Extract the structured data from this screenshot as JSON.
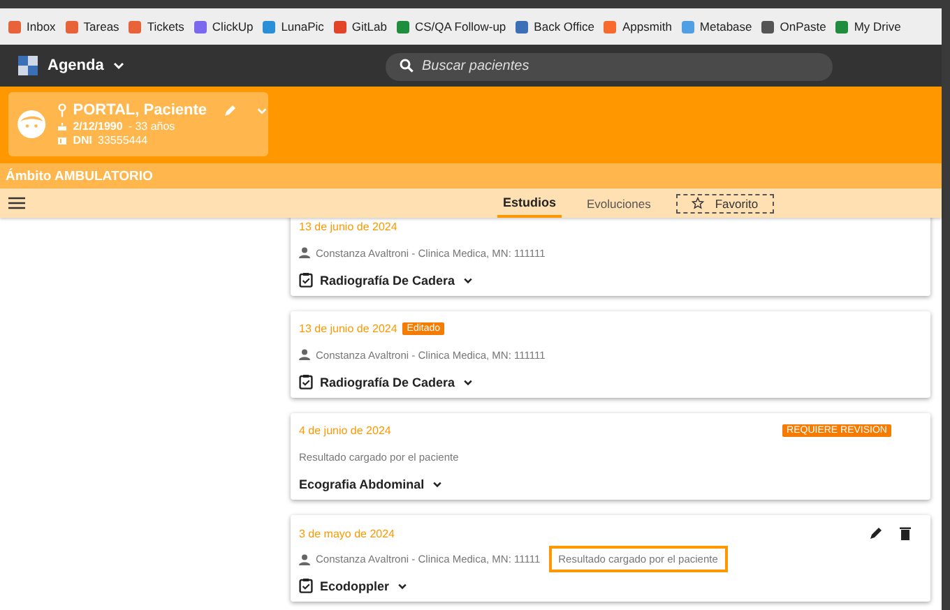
{
  "bookmarks": [
    {
      "label": "Inbox",
      "color": "#e8633a"
    },
    {
      "label": "Tareas",
      "color": "#e8633a"
    },
    {
      "label": "Tickets",
      "color": "#e8633a"
    },
    {
      "label": "ClickUp",
      "color": "#7b68ee"
    },
    {
      "label": "LunaPic",
      "color": "#2a8fd6"
    },
    {
      "label": "GitLab",
      "color": "#e24329"
    },
    {
      "label": "CS/QA Follow-up",
      "color": "#1e8e3e"
    },
    {
      "label": "Back Office",
      "color": "#3b6fb6"
    },
    {
      "label": "Appsmith",
      "color": "#f86a2b"
    },
    {
      "label": "Metabase",
      "color": "#509ee3"
    },
    {
      "label": "OnPaste",
      "color": "#555555"
    },
    {
      "label": "My Drive",
      "color": "#1e8e3e"
    }
  ],
  "app_bar": {
    "title": "Agenda",
    "search": {
      "placeholder": "Buscar pacientes"
    }
  },
  "patient": {
    "name": "PORTAL, Paciente",
    "birth_date": "2/12/1990",
    "age": "- 33 años",
    "dni_label": "DNI",
    "dni": "33555444"
  },
  "scope": "Ámbito AMBULATORIO",
  "tabs": [
    {
      "label": "Estudios",
      "selected": true
    },
    {
      "label": "Evoluciones",
      "selected": false
    }
  ],
  "favorite": {
    "label": "Favorito",
    "on": false
  },
  "studies": [
    {
      "kind": "professional",
      "date": "13 de junio de 2024",
      "doctor": "Constanza Avaltroni - Clinica Medica, MN: 111111",
      "title": "Radiografía De Cadera",
      "editable": false
    },
    {
      "kind": "professional",
      "date": "13 de junio de 2024",
      "edited_tag": "Editado",
      "doctor": "Constanza Avaltroni - Clinica Medica, MN: 111111",
      "title": "Radiografía De Cadera",
      "editable": false
    },
    {
      "kind": "patient",
      "date": "4 de junio de 2024",
      "review_tag": "REQUIERE REVISION",
      "note": "Resultado cargado por el paciente",
      "note_highlighted": false,
      "title": "Ecografia Abdominal",
      "editable": false
    },
    {
      "kind": "professional",
      "date": "3 de mayo de 2024",
      "doctor": "Constanza Avaltroni - Clinica Medica, MN: 11111",
      "note": "Resultado cargado por el paciente",
      "note_highlighted": true,
      "title": "Ecodoppler",
      "editable": true
    }
  ]
}
